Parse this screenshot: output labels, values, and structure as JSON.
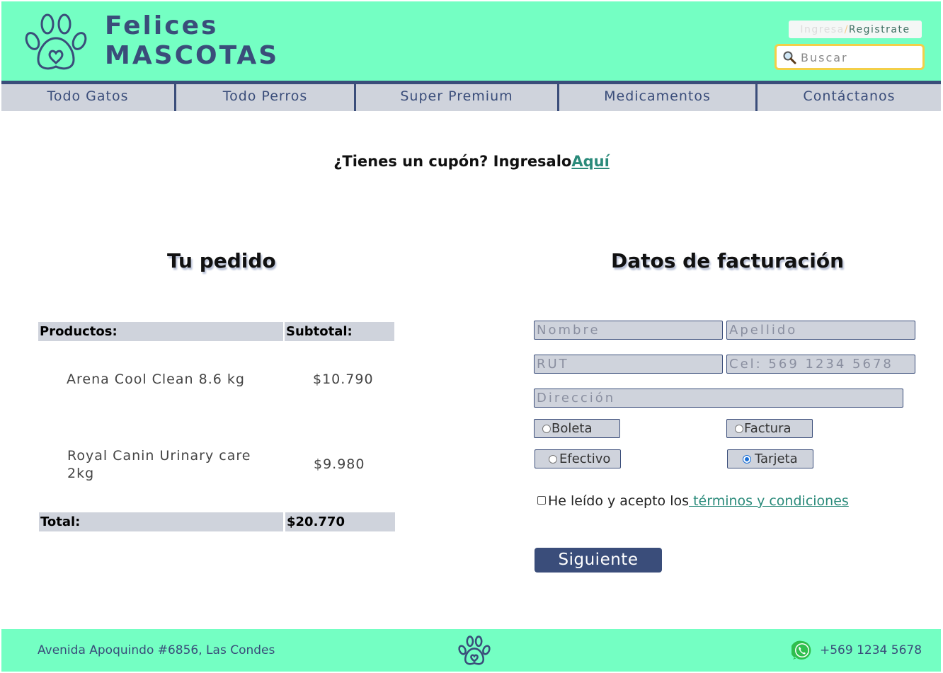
{
  "brand": {
    "line1": "Felices",
    "line2": "MASCOTAS"
  },
  "auth": {
    "login": "Ingresa",
    "separator": "/",
    "register": "Registrate"
  },
  "search": {
    "placeholder": "Buscar",
    "icon": "search-icon"
  },
  "nav": {
    "items": [
      {
        "label": "Todo Gatos"
      },
      {
        "label": "Todo Perros"
      },
      {
        "label": "Super Premium"
      },
      {
        "label": "Medicamentos"
      },
      {
        "label": "Contáctanos"
      }
    ]
  },
  "coupon": {
    "text": "¿Tienes un cupón? Ingresalo",
    "link": "Aquí"
  },
  "order": {
    "title": "Tu pedido",
    "col_products": "Productos:",
    "col_subtotal": "Subtotal:",
    "items": [
      {
        "name": "Arena Cool Clean 8.6 kg",
        "subtotal": "$10.790"
      },
      {
        "name_line1": "Royal Canin Urinary care",
        "name_line2": "2kg",
        "subtotal": "$9.980"
      }
    ],
    "total_label": "Total:",
    "total_value": "$20.770"
  },
  "billing": {
    "title": "Datos de facturación",
    "nombre": "Nombre",
    "apellido": "Apellido",
    "rut": "RUT",
    "cel": "Cel: 569 1234 5678",
    "direccion": "Dirección",
    "doc_options": [
      "Boleta",
      "Factura"
    ],
    "pay_options": [
      "Efectivo",
      "Tarjeta"
    ],
    "selected_payment": "Tarjeta",
    "terms_text": "He leído y acepto los",
    "terms_link": " términos y condiciones",
    "next": "Siguiente"
  },
  "footer": {
    "address": "Avenida Apoquindo #6856, Las Condes",
    "phone": "+569 1234 5678"
  },
  "colors": {
    "mint": "#74ffc3",
    "navy": "#3a4d7a",
    "gray": "#cfd3dc",
    "link": "#2a8a7a",
    "search_border": "#f3cf48"
  }
}
